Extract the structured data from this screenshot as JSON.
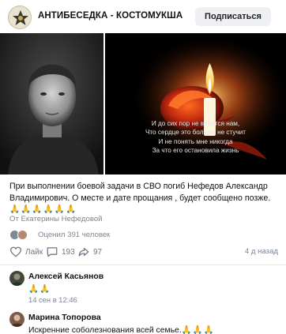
{
  "group": {
    "name": "АНТИБЕСЕДКА - КОСТОМУКША",
    "avatar_icon": "group-emblem-icon",
    "subscribe_label": "Подписаться"
  },
  "post": {
    "candle_text": [
      "И до сих пор не верится нам,",
      "Что сердце это больше не стучит",
      "И не понять мне никогда",
      "За что его остановила жизнь"
    ],
    "text": "При выполнении боевой задачи в СВО погиб Нефедов Александр Владимирович. О месте и дате прощания , будет сообщено позже.",
    "emoji": "🙏🙏🙏🙏🙏🙏",
    "author": "От Екатерины Нефедовой",
    "rating": "Оценил 391 человек",
    "like_label": "Лайк",
    "comments_count": "193",
    "shares_count": "97",
    "date": "4 д назад"
  },
  "comments": [
    {
      "name": "Алексей Касьянов",
      "text": "🙏🙏",
      "time": "14 сен в 12:46"
    },
    {
      "name": "Марина Топорова",
      "text": "Искренние соболезнования всей семье.",
      "emoji": "🙏🙏🙏"
    }
  ],
  "colors": {
    "muted": "#7b8694",
    "icon": "#6d7885",
    "button_bg": "#eef0f3",
    "divider": "#e7e8ec",
    "emoji": "#f0a400"
  }
}
